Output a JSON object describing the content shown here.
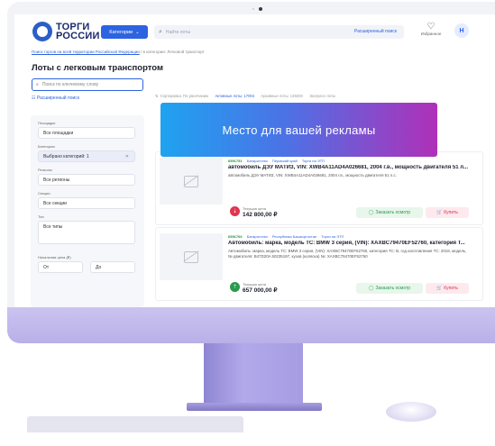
{
  "header": {
    "logo_line1": "ТОРГИ",
    "logo_line2": "РОССИИ",
    "categories_button": "Категории",
    "search_placeholder": "Найти лоты",
    "advanced_search": "Расширенный поиск",
    "favorites_label": "Избранное",
    "avatar_letter": "Н"
  },
  "breadcrumb": {
    "link": "Поиск торгов на всей территории Российской Федерации",
    "rest": "/ в категории: Легковой транспорт"
  },
  "page_title": "Лоты с легковым транспортом",
  "sidebar": {
    "keyword_placeholder": "Поиск по ключевому слову",
    "extended_search": "Расширенный поиск",
    "filters": [
      {
        "label": "Площадки",
        "value": "Все площадки",
        "selected": false
      },
      {
        "label": "Категории",
        "value": "Выбрано категорий: 1",
        "selected": true
      },
      {
        "label": "Регионы",
        "value": "Все регионы",
        "selected": false
      },
      {
        "label": "Секции",
        "value": "Все секции",
        "selected": false
      },
      {
        "label": "Тип",
        "value": "Все типы",
        "selected": false
      }
    ],
    "price_label": "Начальная цена (₽)",
    "price_from": "От",
    "price_to": "До"
  },
  "sort": {
    "label": "Сортировка: По умолчанию",
    "active": "Активные лоты: 17004",
    "archive": "Архивные лоты: 139200",
    "express": "Экспресс-лоты"
  },
  "ad_banner": "Место для вашей рекламы",
  "lots": [
    {
      "id": "6591751",
      "tags": [
        "Банкротство",
        "Пермский край",
        "Торги на ЭТП"
      ],
      "title": "автомобиль ДЭУ МАТИЗ, VIN: XWB4A11AD4A026681, 2004 г.в., мощность двигателя 51 л...",
      "desc": "автомобиль ДЭУ МАТИЗ, VIN: XWB4A11AD4A026681, 2004 г.в., мощность двигателя 51 л.с.",
      "price_label": "Текущая цена",
      "price": "142 800,00 ₽",
      "price_color": "#e0344f",
      "inspect_label": "Заказать осмотр",
      "buy_label": "Купить"
    },
    {
      "id": "6591760",
      "tags": [
        "Банкротство",
        "Республика Башкортостан",
        "Торги на ЭТП"
      ],
      "title": "Автомобиль: марка, модель ТС: BMW 3 серия, (VIN): XAXBC79470EF52760, категория Т...",
      "desc": "Автомобиль: марка, модель ТС: BMW 3 серия, (VIN): XAXBC79470EF52760, категория ТС: B, год изготовления ТС: 2018, модель, № двигателя: B47D20A 50235197, кузов (коляска) №: XAXBC79470EF52760",
      "price_label": "Текущая цена",
      "price": "657 000,00 ₽",
      "price_color": "#2a9a4c",
      "inspect_label": "Заказать осмотр",
      "buy_label": "Купить"
    }
  ]
}
